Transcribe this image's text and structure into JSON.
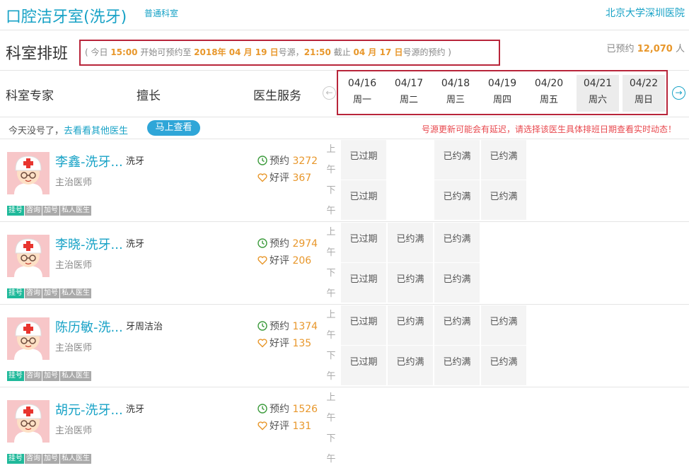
{
  "header": {
    "dept_title": "口腔洁牙室(洗牙)",
    "dept_tag": "普通科室",
    "hospital": "北京大学深圳医院"
  },
  "schedule": {
    "title": "科室排班",
    "notice": {
      "p1": "( 今日 ",
      "t1": "15:00",
      "p2": " 开始可预约至 ",
      "d1": "2018年 04 月 19 日",
      "p3": "号源，",
      "t2": "21:50",
      "p4": " 截止 ",
      "d2": "04 月 17 日",
      "p5": "号源的预约 )"
    },
    "booked_label": "已预约 ",
    "booked_count": "12,070",
    "booked_unit": " 人"
  },
  "columns": {
    "expert": "科室专家",
    "skill": "擅长",
    "service": "医生服务"
  },
  "dates": [
    {
      "date": "04/16",
      "weekday": "周一",
      "weekend": false
    },
    {
      "date": "04/17",
      "weekday": "周二",
      "weekend": false
    },
    {
      "date": "04/18",
      "weekday": "周三",
      "weekend": false
    },
    {
      "date": "04/19",
      "weekday": "周四",
      "weekend": false
    },
    {
      "date": "04/20",
      "weekday": "周五",
      "weekend": false
    },
    {
      "date": "04/21",
      "weekday": "周六",
      "weekend": true
    },
    {
      "date": "04/22",
      "weekday": "周日",
      "weekend": true
    }
  ],
  "hint": {
    "text": "今天没号了，",
    "link": "去看看其他医生",
    "button": "马上查看",
    "warning": "号源更新可能会有延迟，请选择该医生具体排班日期查看实时动态！"
  },
  "labels": {
    "am": [
      "上",
      "午"
    ],
    "pm": [
      "下",
      "午"
    ],
    "appointments": "预约",
    "reviews": "好评"
  },
  "tags": [
    "挂号",
    "咨询",
    "加号",
    "私人医生"
  ],
  "doctors": [
    {
      "name": "李鑫-洗牙...",
      "title": "主治医师",
      "skill": "洗牙",
      "appointments": "3272",
      "reviews": "367",
      "am": [
        "已过期",
        "",
        "已约满",
        "已约满",
        "",
        "",
        ""
      ],
      "pm": [
        "已过期",
        "",
        "已约满",
        "已约满",
        "",
        "",
        ""
      ]
    },
    {
      "name": "李晓-洗牙...",
      "title": "主治医师",
      "skill": "洗牙",
      "appointments": "2974",
      "reviews": "206",
      "am": [
        "已过期",
        "已约满",
        "已约满",
        "",
        "",
        "",
        ""
      ],
      "pm": [
        "已过期",
        "已约满",
        "已约满",
        "",
        "",
        "",
        ""
      ]
    },
    {
      "name": "陈历敏-洗...",
      "title": "主治医师",
      "skill": "牙周洁治",
      "appointments": "1374",
      "reviews": "135",
      "am": [
        "已过期",
        "已约满",
        "已约满",
        "已约满",
        "",
        "",
        ""
      ],
      "pm": [
        "已过期",
        "已约满",
        "已约满",
        "已约满",
        "",
        "",
        ""
      ]
    },
    {
      "name": "胡元-洗牙...",
      "title": "主治医师",
      "skill": "洗牙",
      "appointments": "1526",
      "reviews": "131",
      "am": [
        "",
        "",
        "",
        "",
        "",
        "",
        ""
      ],
      "pm": [
        "",
        "",
        "",
        "",
        "",
        "",
        ""
      ]
    }
  ],
  "colors": {
    "brand": "#17a2c6",
    "highlight": "#e8972b",
    "outline": "#b8253a",
    "warning": "#e8484e"
  }
}
